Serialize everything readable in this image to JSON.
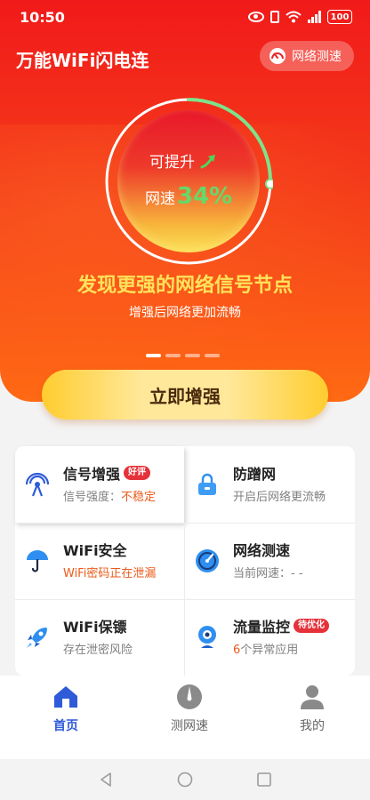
{
  "status_bar": {
    "time": "10:50",
    "battery": "100"
  },
  "header": {
    "title": "万能WiFi闪电连",
    "speedtest_label": "网络测速"
  },
  "hero": {
    "can_raise": "可提升",
    "speed_label": "网速",
    "speed_value": "34%",
    "speed_fraction": 0.34,
    "headline": "发现更强的网络信号节点",
    "subline": "增强后网络更加流畅",
    "slides_total": 4,
    "slide_active": 0
  },
  "boost_button": {
    "label": "立即增强"
  },
  "features": [
    {
      "icon": "signal-tower-icon",
      "title": "信号增强",
      "tag": "好评",
      "sub_prefix": "信号强度：",
      "sub_highlight": "不稳定"
    },
    {
      "icon": "lock-icon",
      "title": "防蹭网",
      "tag": "",
      "sub_prefix": "开启后网络更流畅",
      "sub_highlight": ""
    },
    {
      "icon": "umbrella-icon",
      "title": "WiFi安全",
      "tag": "",
      "sub_prefix": "",
      "sub_highlight": "WiFi密码正在泄漏"
    },
    {
      "icon": "speedometer-icon",
      "title": "网络测速",
      "tag": "",
      "sub_prefix": "当前网速：- -",
      "sub_highlight": ""
    },
    {
      "icon": "rocket-icon",
      "title": "WiFi保镖",
      "tag": "",
      "sub_prefix": "存在泄密风险",
      "sub_highlight": ""
    },
    {
      "icon": "webcam-icon",
      "title": "流量监控",
      "tag": "待优化",
      "sub_highlight": "6",
      "sub_prefix": "个异常应用"
    }
  ],
  "bottom_nav": [
    {
      "label": "首页",
      "icon": "home-icon",
      "active": true
    },
    {
      "label": "测网速",
      "icon": "speed-drop-icon",
      "active": false
    },
    {
      "label": "我的",
      "icon": "user-icon",
      "active": false
    }
  ],
  "colors": {
    "hero_red": "#f11a1a",
    "accent_blue": "#2e5bd8",
    "warn_orange": "#ea5a1a",
    "tag_red": "#e5323a",
    "speed_green": "#66d86a",
    "headline_yellow": "#ffe35a"
  }
}
